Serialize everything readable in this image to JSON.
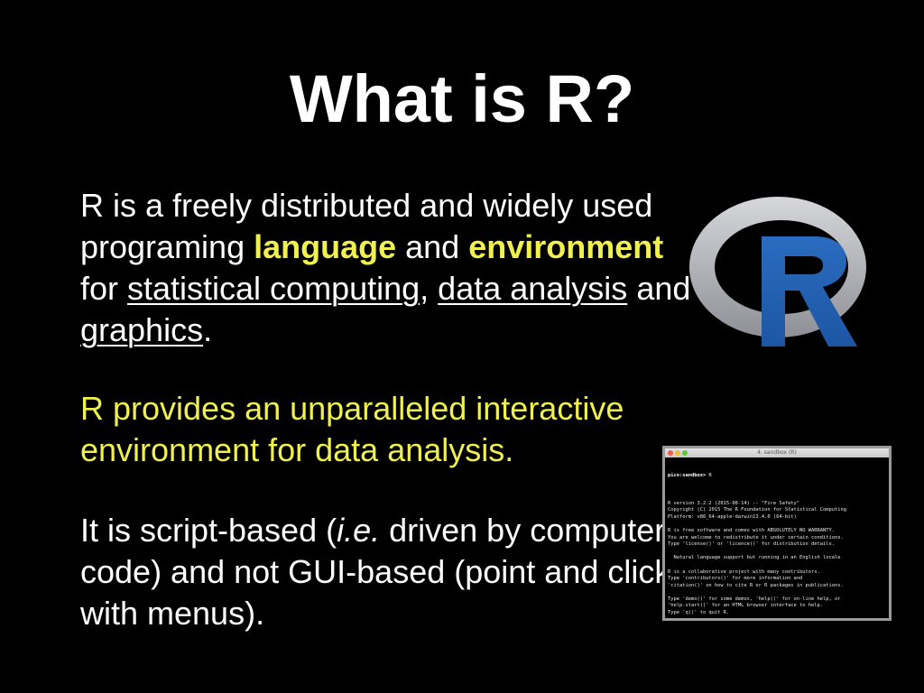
{
  "slide": {
    "title": "What is R?",
    "paragraph1": {
      "t1": "R is a freely distributed and widely used programing ",
      "language": "language",
      "t2": " and ",
      "environment": "environment",
      "t3": " for ",
      "statistical_computing": "statistical computing",
      "t4": ", ",
      "data_analysis": "data analysis",
      "t5": " and ",
      "graphics": "graphics",
      "t6": "."
    },
    "paragraph2": "R provides an unparalleled interactive environment for data analysis.",
    "paragraph3": {
      "t1": "It is script-based (",
      "ie": "i.e.",
      "t2": " driven by computer code)  and not GUI-based (point and click with menus)."
    }
  },
  "logo": {
    "letter": "R",
    "ring_color": "#a9aab0",
    "letter_color": "#2264b6"
  },
  "terminal": {
    "window_title": "4. sandbox (R)",
    "prompt_host": "pico:sandbox>",
    "prompt_cmd": " R",
    "lines": [
      "",
      "R version 3.2.2 (2015-08-14) -- \"Fire Safety\"",
      "Copyright (C) 2015 The R Foundation for Statistical Computing",
      "Platform: x86_64-apple-darwin13.4.0 (64-bit)",
      "",
      "R is free software and comes with ABSOLUTELY NO WARRANTY.",
      "You are welcome to redistribute it under certain conditions.",
      "Type 'license()' or 'licence()' for distribution details.",
      "",
      "  Natural language support but running in an English locale",
      "",
      "R is a collaborative project with many contributors.",
      "Type 'contributors()' for more information and",
      "'citation()' on how to cite R or R packages in publications.",
      "",
      "Type 'demo()' for some demos, 'help()' for on-line help, or",
      "'help.start()' for an HTML browser interface to help.",
      "Type 'q()' to quit R.",
      ""
    ],
    "final_prompt": "> "
  },
  "colors": {
    "background": "#000000",
    "highlight": "#f0f04e",
    "text": "#ffffff"
  }
}
